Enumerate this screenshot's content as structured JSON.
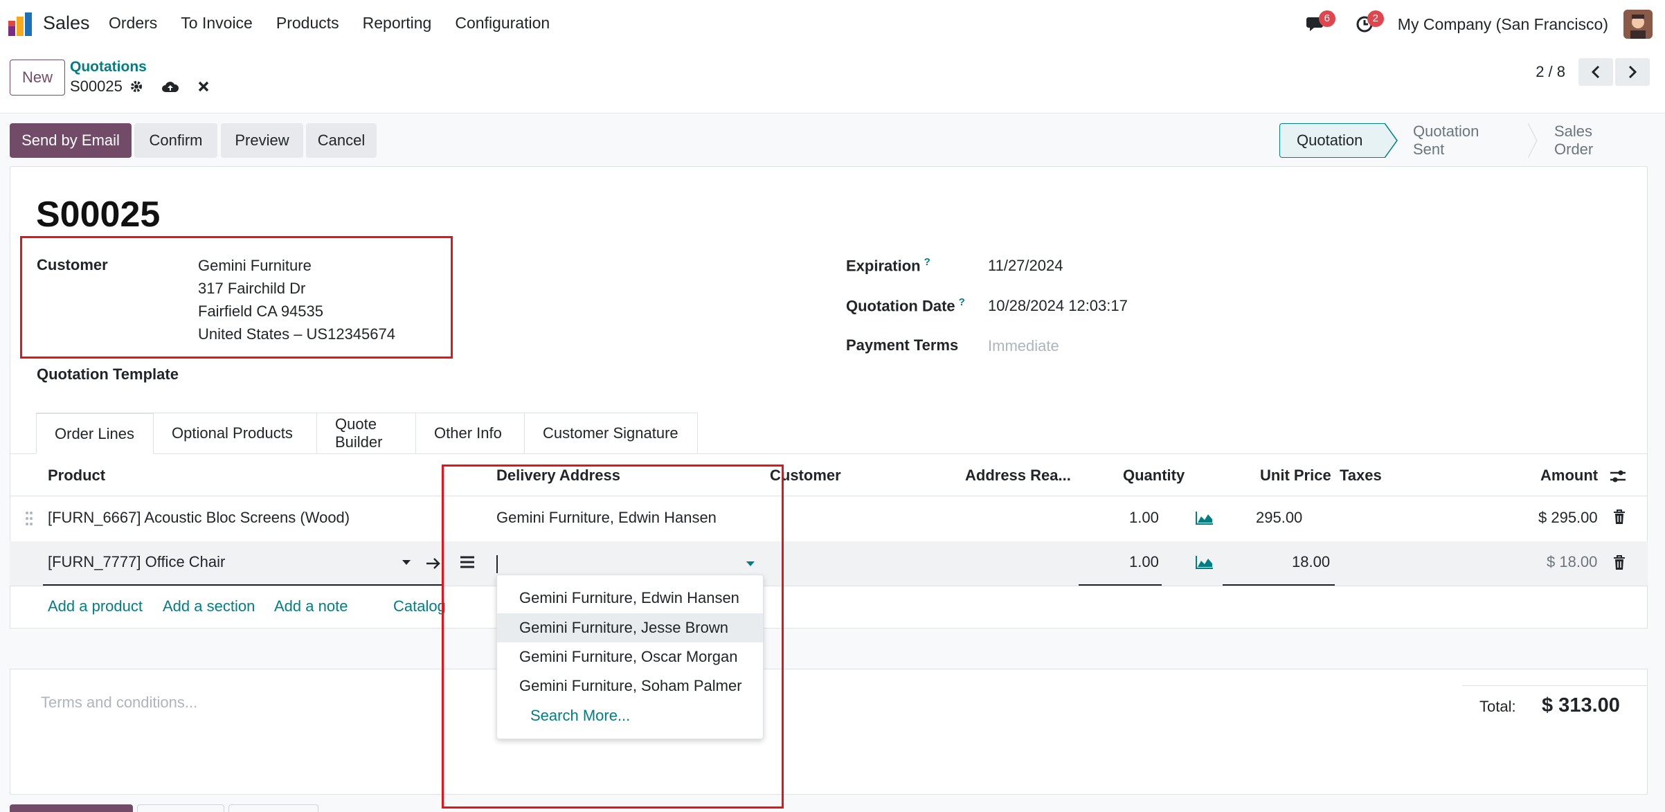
{
  "navbar": {
    "app_name": "Sales",
    "menu": [
      "Orders",
      "To Invoice",
      "Products",
      "Reporting",
      "Configuration"
    ],
    "messages_badge": "6",
    "activities_badge": "2",
    "company": "My Company (San Francisco)"
  },
  "control_panel": {
    "new_label": "New",
    "breadcrumb": "Quotations",
    "record_name": "S00025",
    "pager": "2 / 8"
  },
  "statusbar": {
    "buttons": [
      "Send by Email",
      "Confirm",
      "Preview",
      "Cancel"
    ],
    "stages": [
      "Quotation",
      "Quotation Sent",
      "Sales Order"
    ],
    "active_stage": "Quotation"
  },
  "form": {
    "title": "S00025",
    "customer_label": "Customer",
    "customer": [
      "Gemini Furniture",
      "317 Fairchild Dr",
      "Fairfield CA 94535",
      "United States – US12345674"
    ],
    "expiration_label": "Expiration",
    "expiration_help": "?",
    "expiration": "11/27/2024",
    "quotation_date_label": "Quotation Date",
    "quotation_date_help": "?",
    "quotation_date": "10/28/2024 12:03:17",
    "payment_terms_label": "Payment Terms",
    "payment_terms_placeholder": "Immediate",
    "template_label": "Quotation Template"
  },
  "tabs": [
    "Order Lines",
    "Optional Products",
    "Quote Builder",
    "Other Info",
    "Customer Signature"
  ],
  "table": {
    "headers": {
      "product": "Product",
      "delivery_address": "Delivery Address",
      "customer": "Customer",
      "address_ready": "Address Rea...",
      "quantity": "Quantity",
      "unit_price": "Unit Price",
      "taxes": "Taxes",
      "amount": "Amount"
    },
    "rows": [
      {
        "product": "[FURN_6667] Acoustic Bloc Screens (Wood)",
        "delivery_address": "Gemini Furniture, Edwin Hansen",
        "quantity": "1.00",
        "unit_price": "295.00",
        "amount": "$ 295.00"
      },
      {
        "product": "[FURN_7777] Office Chair",
        "delivery_address": "",
        "quantity": "1.00",
        "unit_price": "18.00",
        "amount": "$ 18.00"
      }
    ],
    "add_links": [
      "Add a product",
      "Add a section",
      "Add a note",
      "Catalog"
    ]
  },
  "dropdown": {
    "options": [
      "Gemini Furniture, Edwin Hansen",
      "Gemini Furniture, Jesse Brown",
      "Gemini Furniture, Oscar Morgan",
      "Gemini Furniture, Soham Palmer"
    ],
    "highlighted": "Gemini Furniture, Jesse Brown",
    "search_more": "Search More..."
  },
  "footer": {
    "terms_placeholder": "Terms and conditions...",
    "total_label": "Total:",
    "total_value": "$ 313.00"
  },
  "colors": {
    "primary": "#714b67",
    "link": "#017e84",
    "highlight_box": "#e3151b",
    "badge": "#e0464e"
  }
}
